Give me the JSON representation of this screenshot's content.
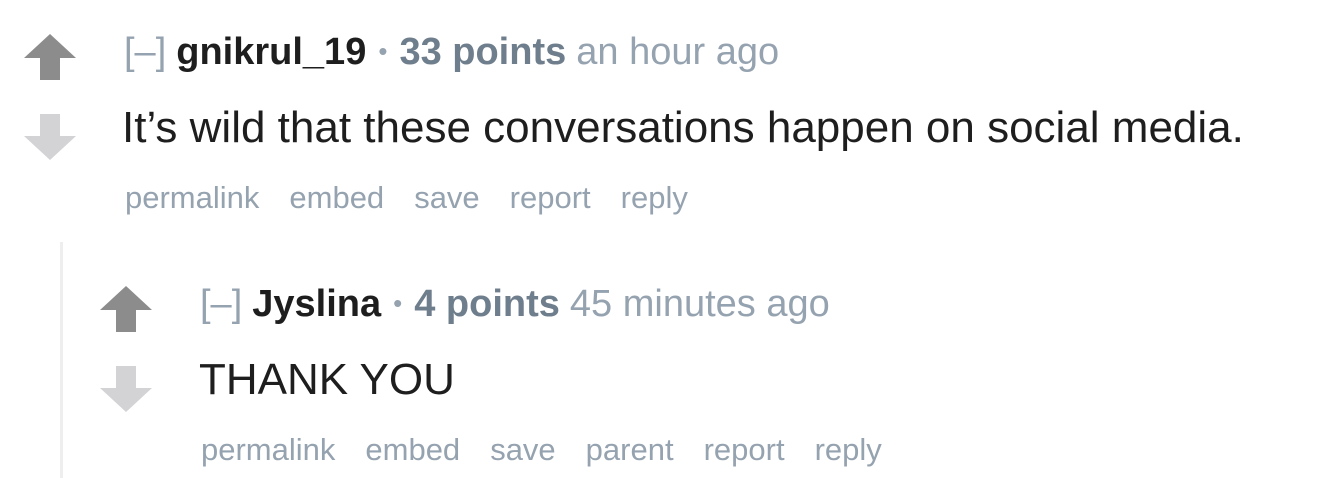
{
  "comments": [
    {
      "toggle": "[–]",
      "author": "gnikrul_19",
      "separator": "•",
      "score": "33 points",
      "time": "an hour ago",
      "body": "It’s wild that these conversations happen on social media.",
      "actions": [
        "permalink",
        "embed",
        "save",
        "report",
        "reply"
      ]
    },
    {
      "toggle": "[–]",
      "author": "Jyslina",
      "separator": "•",
      "score": "4 points",
      "time": "45 minutes ago",
      "body": "THANK YOU",
      "actions": [
        "permalink",
        "embed",
        "save",
        "parent",
        "report",
        "reply"
      ]
    }
  ],
  "colors": {
    "upvote": "#8c8c8c",
    "downvote": "#d3d3d6",
    "meta": "#95a2af",
    "score": "#6f7e8c",
    "text": "#1e1e1e"
  },
  "icons": [
    "upvote-arrow-icon",
    "downvote-arrow-icon"
  ]
}
